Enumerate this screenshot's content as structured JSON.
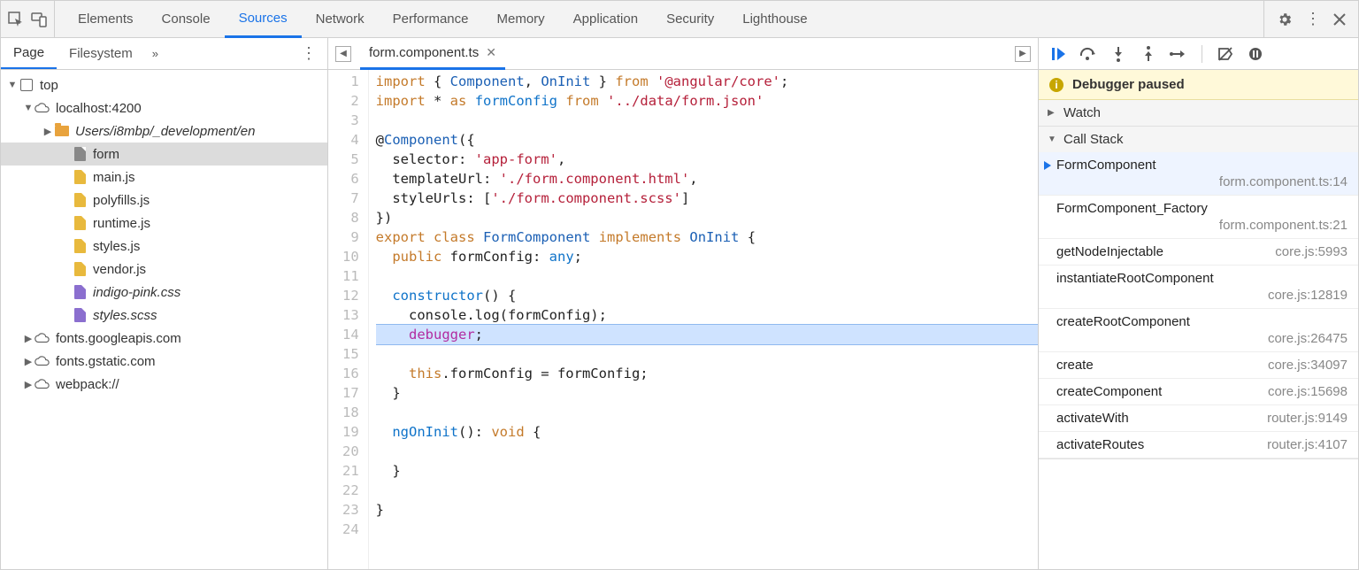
{
  "topbar": {
    "tabs": [
      "Elements",
      "Console",
      "Sources",
      "Network",
      "Performance",
      "Memory",
      "Application",
      "Security",
      "Lighthouse"
    ],
    "active": "Sources"
  },
  "left": {
    "tabs": {
      "page": "Page",
      "filesystem": "Filesystem"
    },
    "tree": {
      "top": "top",
      "host": "localhost:4200",
      "folder": "Users/i8mbp/_development/en",
      "files": {
        "form": "form",
        "main": "main.js",
        "polyfills": "polyfills.js",
        "runtime": "runtime.js",
        "styles": "styles.js",
        "vendor": "vendor.js",
        "indigo": "indigo-pink.css",
        "scss": "styles.scss"
      },
      "ext1": "fonts.googleapis.com",
      "ext2": "fonts.gstatic.com",
      "ext3": "webpack://"
    }
  },
  "mid": {
    "filename": "form.component.ts",
    "lines": [
      [
        [
          "kw",
          "import"
        ],
        [
          "punc",
          " { "
        ],
        [
          "type",
          "Component"
        ],
        [
          "punc",
          ", "
        ],
        [
          "type",
          "OnInit"
        ],
        [
          "punc",
          " } "
        ],
        [
          "kw",
          "from"
        ],
        [
          "punc",
          " "
        ],
        [
          "str",
          "'@angular/core'"
        ],
        [
          "punc",
          ";"
        ]
      ],
      [
        [
          "kw",
          "import"
        ],
        [
          "punc",
          " * "
        ],
        [
          "kw",
          "as"
        ],
        [
          "punc",
          " "
        ],
        [
          "id",
          "formConfig"
        ],
        [
          "punc",
          " "
        ],
        [
          "kw",
          "from"
        ],
        [
          "punc",
          " "
        ],
        [
          "str",
          "'../data/form.json'"
        ]
      ],
      [],
      [
        [
          "punc",
          "@"
        ],
        [
          "type",
          "Component"
        ],
        [
          "punc",
          "({"
        ]
      ],
      [
        [
          "plain",
          "  selector: "
        ],
        [
          "str",
          "'app-form'"
        ],
        [
          "punc",
          ","
        ]
      ],
      [
        [
          "plain",
          "  templateUrl: "
        ],
        [
          "str",
          "'./form.component.html'"
        ],
        [
          "punc",
          ","
        ]
      ],
      [
        [
          "plain",
          "  styleUrls: ["
        ],
        [
          "str",
          "'./form.component.scss'"
        ],
        [
          "punc",
          "]"
        ]
      ],
      [
        [
          "punc",
          "})"
        ]
      ],
      [
        [
          "kw",
          "export"
        ],
        [
          "punc",
          " "
        ],
        [
          "kw",
          "class"
        ],
        [
          "punc",
          " "
        ],
        [
          "type",
          "FormComponent"
        ],
        [
          "punc",
          " "
        ],
        [
          "kw",
          "implements"
        ],
        [
          "punc",
          " "
        ],
        [
          "type",
          "OnInit"
        ],
        [
          "punc",
          " {"
        ]
      ],
      [
        [
          "plain",
          "  "
        ],
        [
          "kw",
          "public"
        ],
        [
          "plain",
          " formConfig: "
        ],
        [
          "id",
          "any"
        ],
        [
          "punc",
          ";"
        ]
      ],
      [],
      [
        [
          "plain",
          "  "
        ],
        [
          "id",
          "constructor"
        ],
        [
          "punc",
          "() {"
        ]
      ],
      [
        [
          "plain",
          "    console.log(formConfig);"
        ]
      ],
      [
        [
          "plain",
          "    "
        ],
        [
          "dbg",
          "debugger"
        ],
        [
          "punc",
          ";"
        ]
      ],
      [],
      [
        [
          "plain",
          "    "
        ],
        [
          "kw",
          "this"
        ],
        [
          "plain",
          ".formConfig = formConfig;"
        ]
      ],
      [
        [
          "plain",
          "  }"
        ]
      ],
      [],
      [
        [
          "plain",
          "  "
        ],
        [
          "id",
          "ngOnInit"
        ],
        [
          "punc",
          "(): "
        ],
        [
          "kw",
          "void"
        ],
        [
          "punc",
          " {"
        ]
      ],
      [],
      [
        [
          "plain",
          "  }"
        ]
      ],
      [],
      [
        [
          "punc",
          "}"
        ]
      ],
      []
    ],
    "highlight_line": 14
  },
  "right": {
    "paused": "Debugger paused",
    "sections": {
      "watch": "Watch",
      "callstack": "Call Stack"
    },
    "stack": [
      {
        "fn": "FormComponent",
        "loc": "form.component.ts:14",
        "current": true,
        "twoline": true
      },
      {
        "fn": "FormComponent_Factory",
        "loc": "form.component.ts:21",
        "twoline": true
      },
      {
        "fn": "getNodeInjectable",
        "loc": "core.js:5993"
      },
      {
        "fn": "instantiateRootComponent",
        "loc": "core.js:12819",
        "twoline": true
      },
      {
        "fn": "createRootComponent",
        "loc": "core.js:26475",
        "twoline": true
      },
      {
        "fn": "create",
        "loc": "core.js:34097"
      },
      {
        "fn": "createComponent",
        "loc": "core.js:15698"
      },
      {
        "fn": "activateWith",
        "loc": "router.js:9149"
      },
      {
        "fn": "activateRoutes",
        "loc": "router.js:4107"
      }
    ]
  }
}
